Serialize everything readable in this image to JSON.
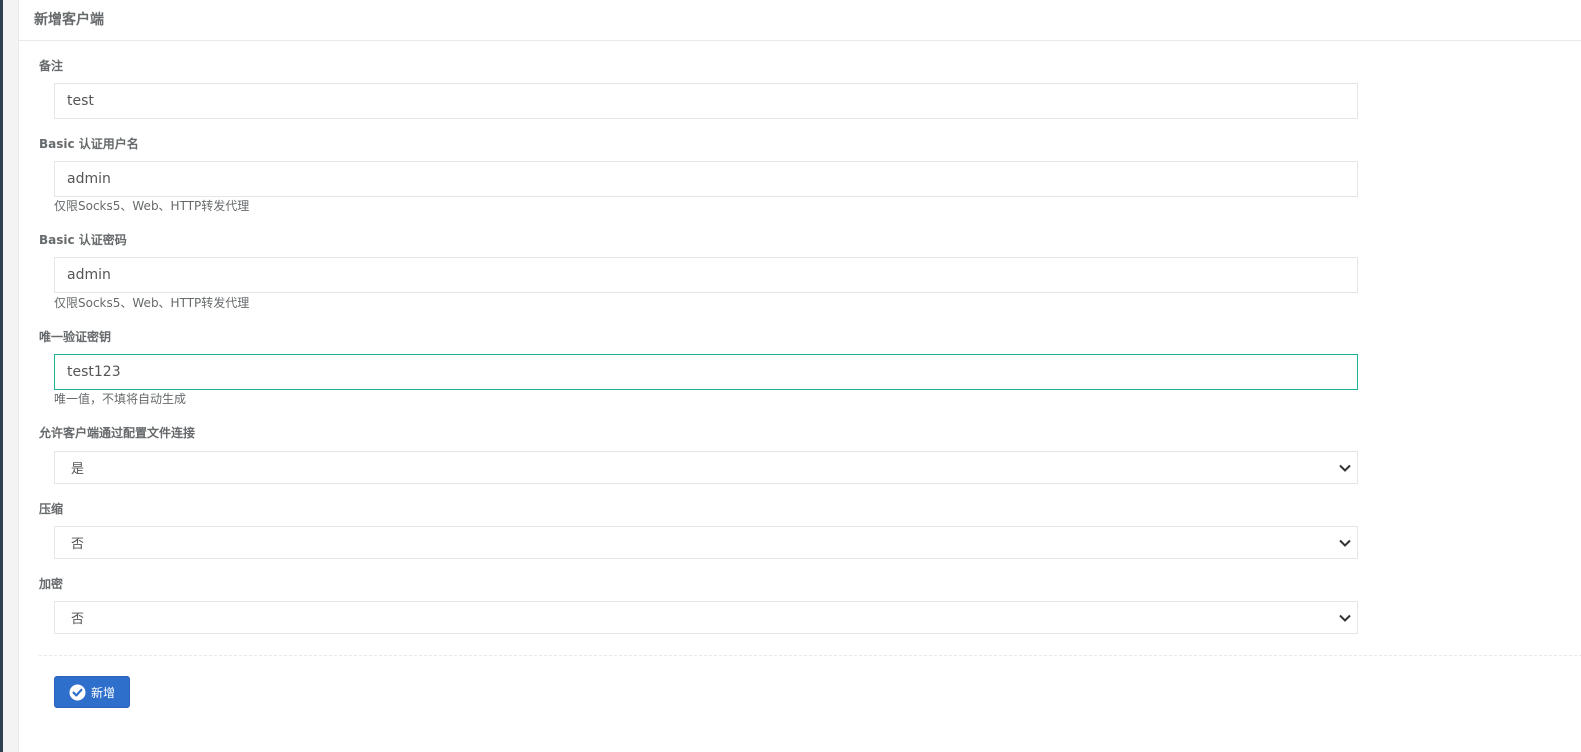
{
  "panel": {
    "title": "新增客户端"
  },
  "form": {
    "remark": {
      "label": "备注",
      "value": "test"
    },
    "basic_user": {
      "label": "Basic 认证用户名",
      "value": "admin",
      "help": "仅限Socks5、Web、HTTP转发代理"
    },
    "basic_password": {
      "label": "Basic 认证密码",
      "value": "admin",
      "help": "仅限Socks5、Web、HTTP转发代理"
    },
    "vkey": {
      "label": "唯一验证密钥",
      "value": "test123",
      "help": "唯一值，不填将自动生成"
    },
    "config_conn": {
      "label": "允许客户端通过配置文件连接",
      "value": "是"
    },
    "compress": {
      "label": "压缩",
      "value": "否"
    },
    "crypt": {
      "label": "加密",
      "value": "否"
    }
  },
  "submit": {
    "label": "新增",
    "icon": "check-circle-icon"
  },
  "colors": {
    "focus_border": "#1ab394",
    "button_bg": "#2f6fcc",
    "sidebar": "#2f4050"
  }
}
